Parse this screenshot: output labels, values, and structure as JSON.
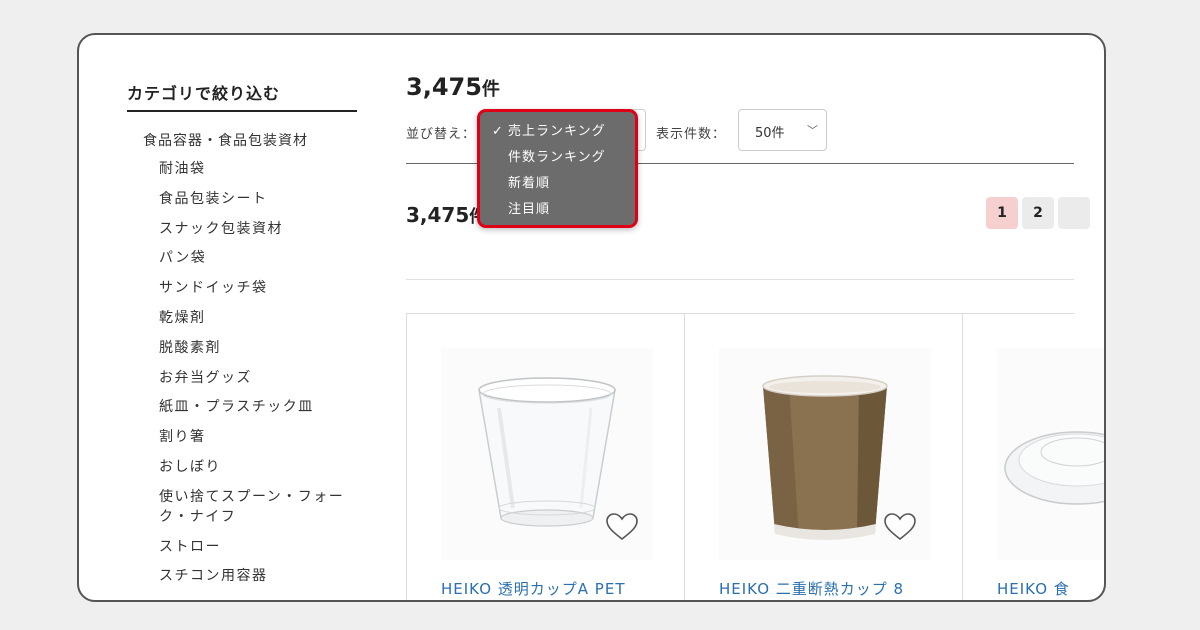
{
  "sidebar": {
    "title": "カテゴリで絞り込む",
    "parent": "食品容器・食品包装資材",
    "items": [
      "耐油袋",
      "食品包装シート",
      "スナック包装資材",
      "パン袋",
      "サンドイッチ袋",
      "乾燥剤",
      "脱酸素剤",
      "お弁当グッズ",
      "紙皿・プラスチック皿",
      "割り箸",
      "おしぼり",
      "使い捨てスプーン・フォーク・ナイフ",
      "ストロー",
      "スチコン用容器"
    ]
  },
  "results": {
    "count": "3,475",
    "unit": "件"
  },
  "controls": {
    "sort_label": "並び替え：",
    "per_page_label": "表示件数：",
    "per_page_value": "50件"
  },
  "sort_dropdown": {
    "options": [
      {
        "label": "売上ランキング",
        "selected": true,
        "check": "✓"
      },
      {
        "label": "件数ランキング",
        "selected": false
      },
      {
        "label": "新着順",
        "selected": false
      },
      {
        "label": "注目順",
        "selected": false
      }
    ]
  },
  "pagination": {
    "pages": [
      "1",
      "2",
      ""
    ],
    "current": "1"
  },
  "products": [
    {
      "title": "HEIKO 透明カップA PET",
      "image": "clear-plastic-cup"
    },
    {
      "title": "HEIKO 二重断熱カップ 8",
      "image": "kraft-paper-cup"
    },
    {
      "title": "HEIKO 食",
      "image": "plastic-lid"
    }
  ],
  "colors": {
    "accent_red": "#e00016",
    "link_blue": "#2a6fb0",
    "page_active_bg": "#f6d0cf"
  }
}
